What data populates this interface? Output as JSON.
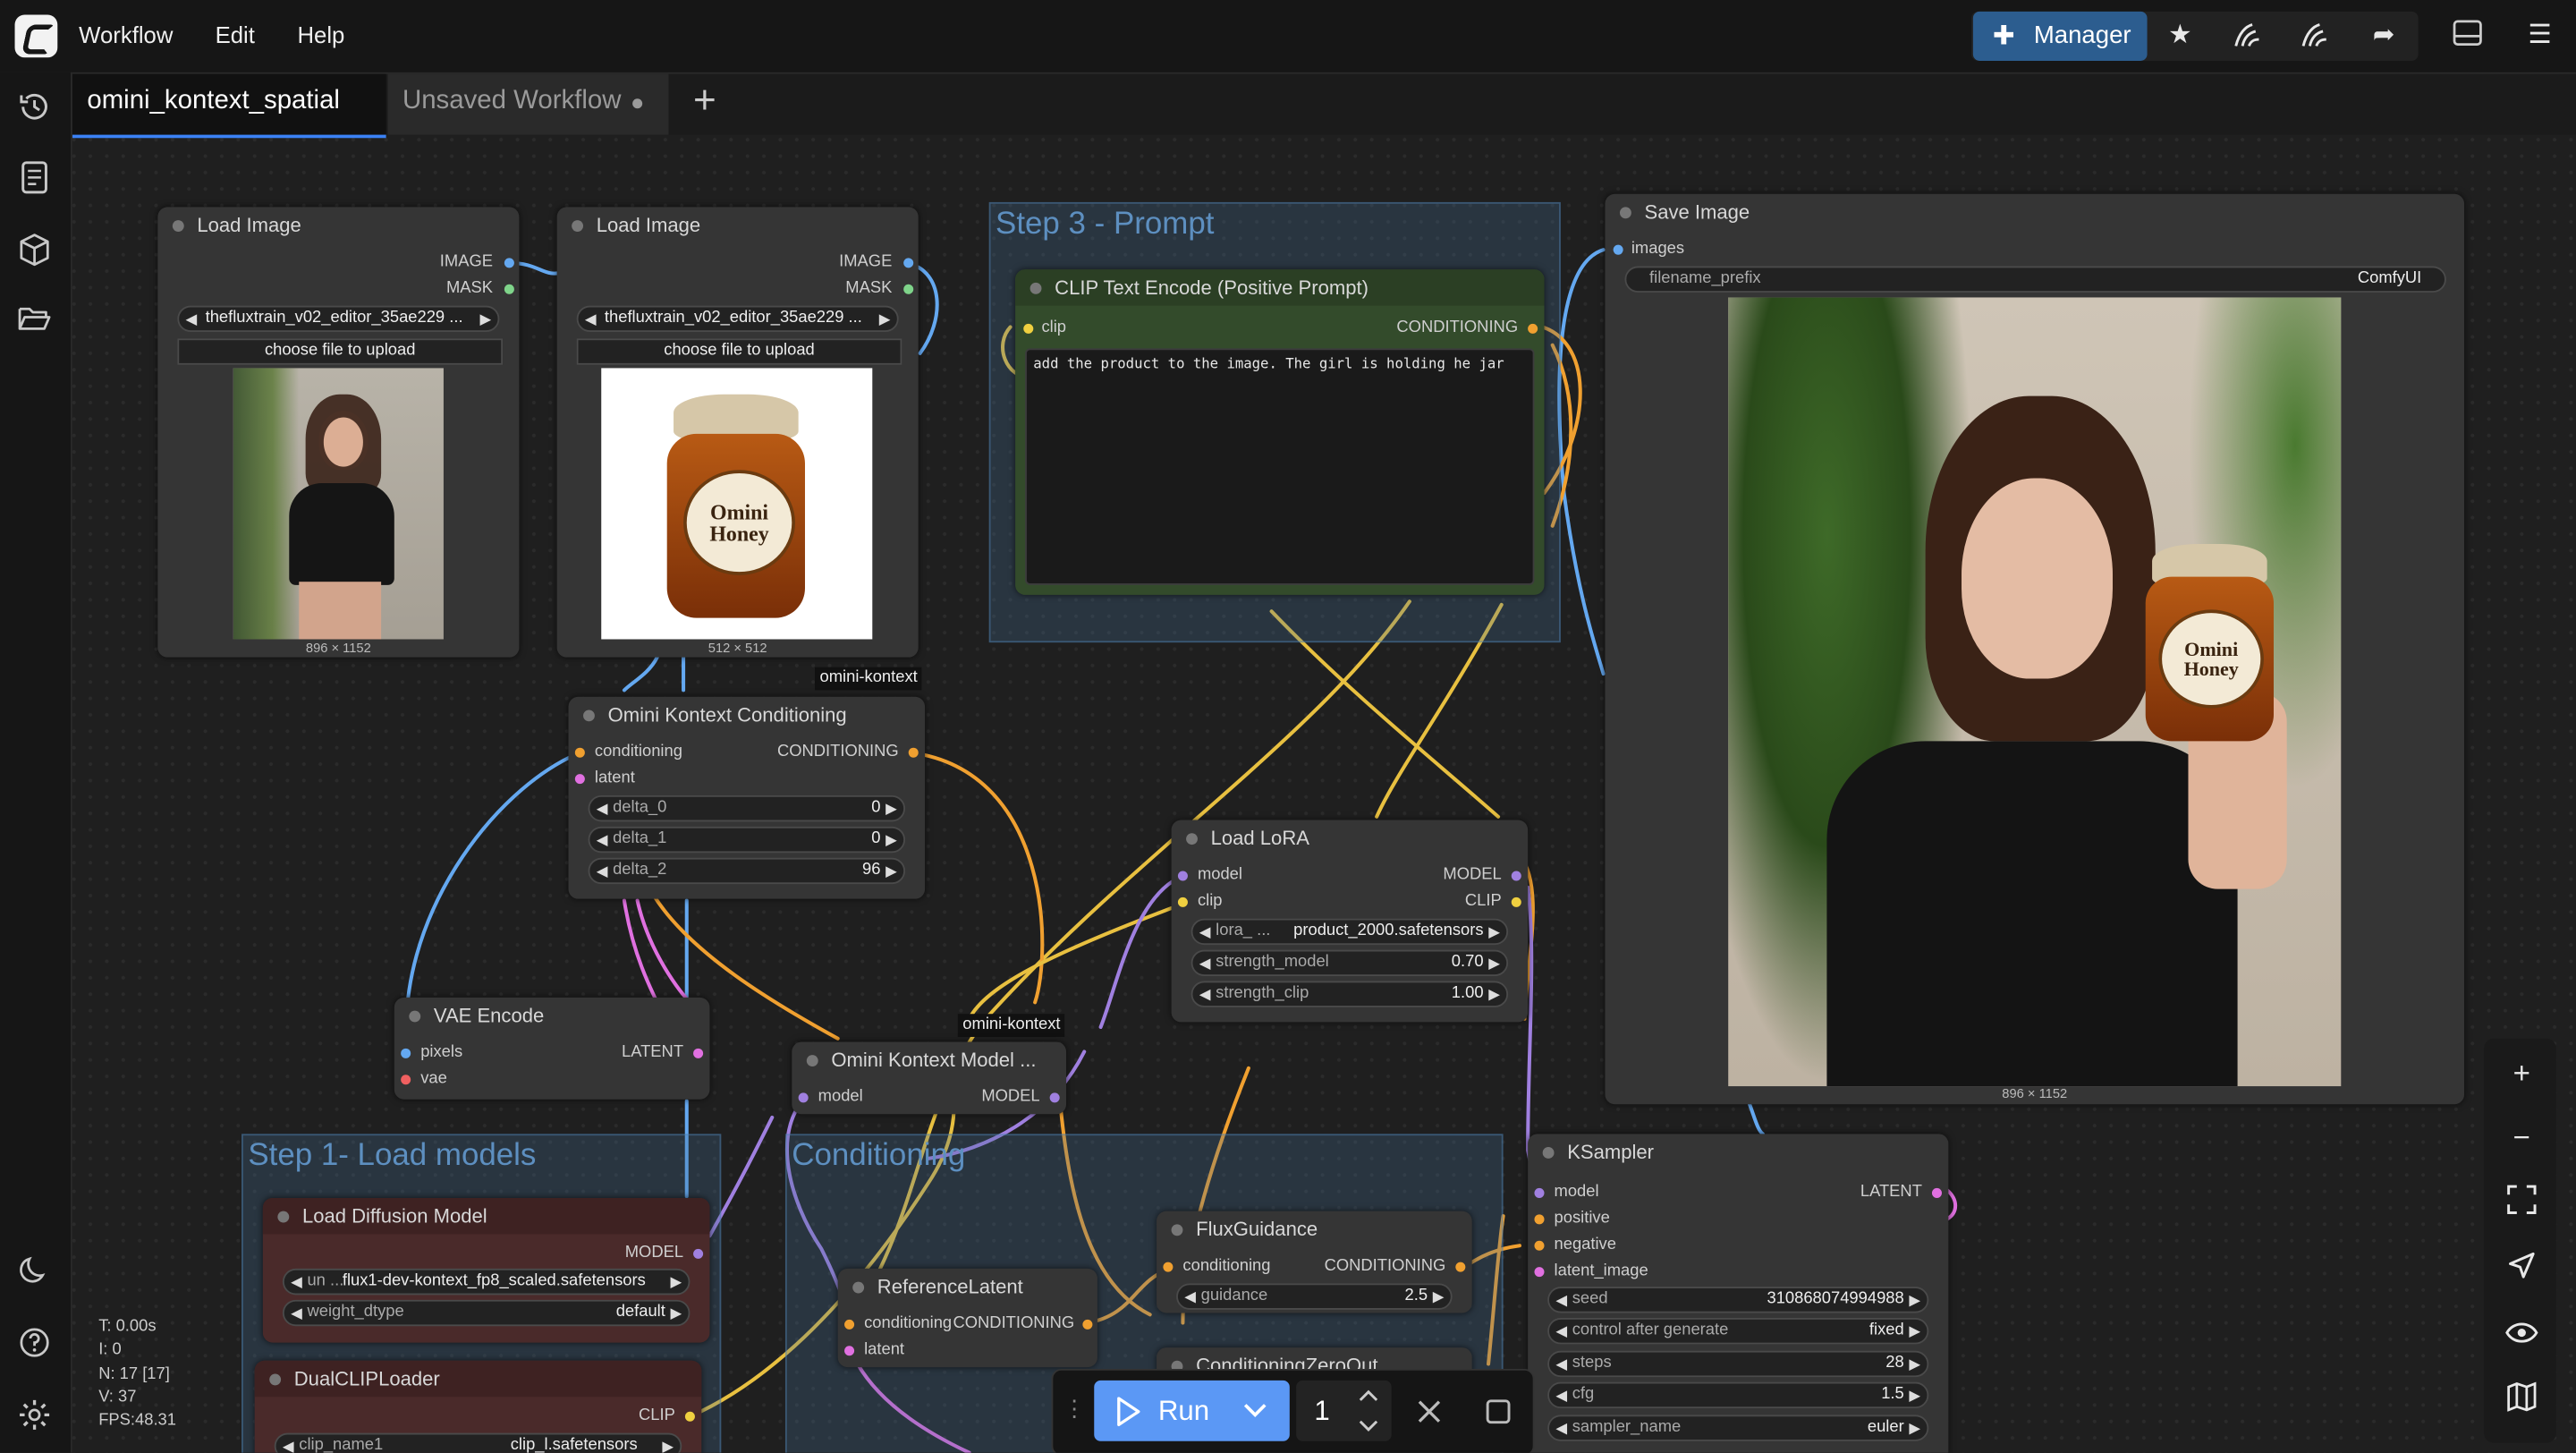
{
  "menu": {
    "workflow": "Workflow",
    "edit": "Edit",
    "help": "Help"
  },
  "manager": {
    "label": "Manager"
  },
  "tabs": [
    {
      "label": "omini_kontext_spatial"
    },
    {
      "label": "Unsaved Workflow"
    }
  ],
  "load_image_1": {
    "title": "Load Image",
    "out_image": "IMAGE",
    "out_mask": "MASK",
    "file": "thefluxtrain_v02_editor_35ae229 ...",
    "upload": "choose file to upload",
    "size": "896 × 1152"
  },
  "load_image_2": {
    "title": "Load Image",
    "out_image": "IMAGE",
    "out_mask": "MASK",
    "file": "thefluxtrain_v02_editor_35ae229 ...",
    "upload": "choose file to upload",
    "size": "512 × 512",
    "jar_text1": "Omini",
    "jar_text2": "Honey"
  },
  "step3": {
    "title": "Step 3 - Prompt"
  },
  "clip_text": {
    "title": "CLIP Text Encode (Positive Prompt)",
    "in_clip": "clip",
    "out": "CONDITIONING",
    "prompt": "add the product to the image. The girl is holding he jar"
  },
  "save_image": {
    "title": "Save Image",
    "in_images": "images",
    "prefix_label": "filename_prefix",
    "prefix_value": "ComfyUI",
    "size": "896 × 1152",
    "jar_text1": "Omini",
    "jar_text2": "Honey"
  },
  "badge1": "omini-kontext",
  "badge2": "omini-kontext",
  "omini_cond": {
    "title": "Omini Kontext Conditioning",
    "in_cond": "conditioning",
    "in_latent": "latent",
    "out": "CONDITIONING",
    "widgets": [
      {
        "label": "delta_0",
        "value": "0"
      },
      {
        "label": "delta_1",
        "value": "0"
      },
      {
        "label": "delta_2",
        "value": "96"
      }
    ]
  },
  "load_lora": {
    "title": "Load LoRA",
    "in_model": "model",
    "in_clip": "clip",
    "out_model": "MODEL",
    "out_clip": "CLIP",
    "lora_label": "lora_ ...",
    "lora_value": "product_2000.safetensors",
    "strength_model_label": "strength_model",
    "strength_model": "0.70",
    "strength_clip_label": "strength_clip",
    "strength_clip": "1.00"
  },
  "vae_encode": {
    "title": "VAE Encode",
    "in_pixels": "pixels",
    "in_vae": "vae",
    "out": "LATENT"
  },
  "omini_model": {
    "title": "Omini Kontext Model ...",
    "in_model": "model",
    "out": "MODEL"
  },
  "step1": {
    "title": "Step 1- Load models"
  },
  "conditioning_group": {
    "title": "Conditioning"
  },
  "diffusion": {
    "title": "Load Diffusion Model",
    "out": "MODEL",
    "unet_label": "un ...",
    "unet_value": "flux1-dev-kontext_fp8_scaled.safetensors",
    "dtype_label": "weight_dtype",
    "dtype_value": "default"
  },
  "dualclip": {
    "title": "DualCLIPLoader",
    "out": "CLIP",
    "clip1_label": "clip_name1",
    "clip1_value": "clip_l.safetensors"
  },
  "ref_latent": {
    "title": "ReferenceLatent",
    "in_cond": "conditioning",
    "in_latent": "latent",
    "out": "CONDITIONING"
  },
  "flux_guidance": {
    "title": "FluxGuidance",
    "in_cond": "conditioning",
    "out": "CONDITIONING",
    "guidance_label": "guidance",
    "guidance_value": "2.5"
  },
  "cond_zero": {
    "title": "ConditioningZeroOut"
  },
  "ksampler": {
    "title": "KSampler",
    "in_model": "model",
    "in_pos": "positive",
    "in_neg": "negative",
    "in_latent": "latent_image",
    "out": "LATENT",
    "widgets": [
      {
        "label": "seed",
        "value": "310868074994988"
      },
      {
        "label": "control after generate",
        "value": "fixed"
      },
      {
        "label": "steps",
        "value": "28"
      },
      {
        "label": "cfg",
        "value": "1.5"
      },
      {
        "label": "sampler_name",
        "value": "euler"
      }
    ]
  },
  "stats": {
    "t": "T: 0.00s",
    "i": "I: 0",
    "n": "N: 17 [17]",
    "v": "V: 37",
    "fps": "FPS:48.31"
  },
  "run": {
    "label": "Run",
    "count": "1"
  },
  "colors": {
    "accent": "#3b82f6",
    "manager": "#2c5d8f",
    "run": "#5b98f5",
    "group": "#436e96",
    "prompt_node": "#334b2b",
    "loader_node": "#4a2a2a"
  }
}
